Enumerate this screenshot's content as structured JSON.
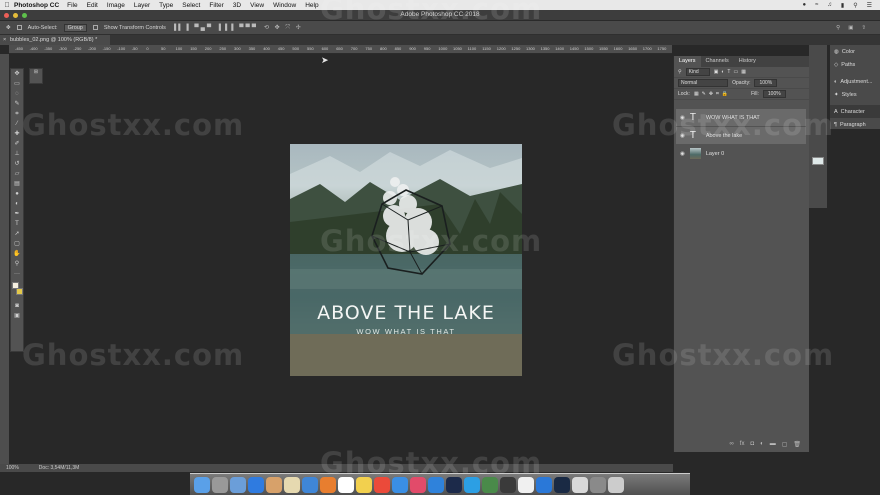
{
  "mac_menu": {
    "app": "Photoshop CC",
    "items": [
      "File",
      "Edit",
      "Image",
      "Layer",
      "Type",
      "Select",
      "Filter",
      "3D",
      "View",
      "Window",
      "Help"
    ]
  },
  "window": {
    "title": "Adobe Photoshop CC 2018"
  },
  "options_bar": {
    "auto_select_label": "Auto-Select:",
    "auto_select_value": "Group",
    "transform_label": "Show Transform Controls"
  },
  "document_tab": {
    "label": "bubbles_02.png @ 100% (RGB/8) *"
  },
  "ruler_ticks": [
    "-450",
    "-400",
    "-350",
    "-300",
    "-250",
    "-200",
    "-150",
    "-100",
    "-50",
    "0",
    "50",
    "100",
    "150",
    "200",
    "250",
    "300",
    "350",
    "400",
    "450",
    "500",
    "550",
    "600",
    "650",
    "700",
    "750",
    "800",
    "850",
    "900",
    "950",
    "1000",
    "1050",
    "1100",
    "1150",
    "1200",
    "1250",
    "1300",
    "1350",
    "1400",
    "1450",
    "1500",
    "1550",
    "1600",
    "1650",
    "1700",
    "1750"
  ],
  "canvas": {
    "headline": "ABOVE THE LAKE",
    "subline": "WOW WHAT IS THAT"
  },
  "layers_panel": {
    "tabs": [
      "Layers",
      "Channels",
      "History"
    ],
    "filter_label": "Kind",
    "blend_mode": "Normal",
    "opacity_label": "Opacity:",
    "opacity_value": "100%",
    "lock_label": "Lock:",
    "fill_label": "Fill:",
    "fill_value": "100%",
    "layers": [
      {
        "name": "WOW WHAT IS THAT",
        "type": "text"
      },
      {
        "name": "Above the lake",
        "type": "text"
      },
      {
        "name": "Layer 0",
        "type": "image"
      }
    ]
  },
  "right_dock": {
    "items": [
      "Color",
      "Paths",
      "Adjustment...",
      "Styles",
      "Character",
      "Paragraph"
    ]
  },
  "status_bar": {
    "zoom": "100%",
    "doc_info": "Doc: 3,54M/11,3M"
  },
  "watermark": "Ghostxx.com",
  "colors": {
    "foreground": "#f5efe0",
    "background": "#e3c84a",
    "dock_icons": [
      "#5aa0e8",
      "#999999",
      "#6b9ed9",
      "#2f7be0",
      "#d7a16a",
      "#e6d9b0",
      "#3f86d7",
      "#e87e2f",
      "#ffffff",
      "#f2d04e",
      "#eb4a3a",
      "#3a8fe5",
      "#e24b6a",
      "#2f82db",
      "#1c2a4a",
      "#2c9fe4",
      "#4a8a4a",
      "#3a3a3a",
      "#f0f0f0",
      "#2a78d8",
      "#1a2a44",
      "#d9d9d9",
      "#8a8a8a",
      "#cccccc"
    ]
  }
}
